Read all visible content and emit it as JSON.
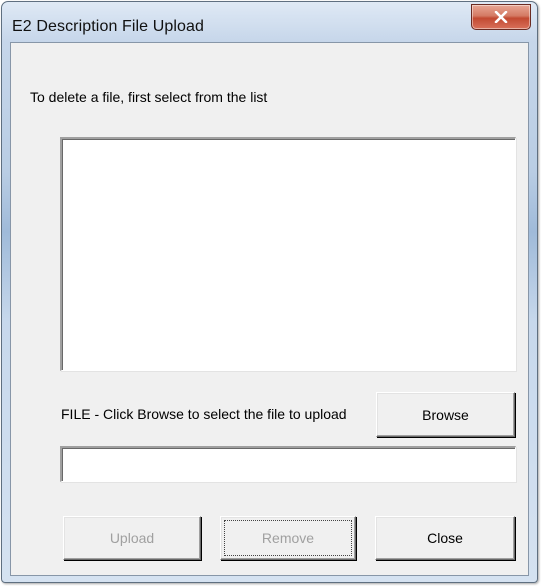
{
  "window": {
    "title": "E2 Description File Upload",
    "close_icon": "close-x-icon"
  },
  "instruction": "To delete a file, first select from the list",
  "file_list": {
    "items": []
  },
  "file_section": {
    "label": "FILE - Click Browse to select the file to upload",
    "browse_label": "Browse",
    "path_value": ""
  },
  "buttons": {
    "upload_label": "Upload",
    "upload_enabled": false,
    "remove_label": "Remove",
    "remove_enabled": false,
    "close_label": "Close"
  },
  "colors": {
    "disabled_text": "#a0a0a0",
    "dialog_face": "#f0f0f0",
    "close_button_red": "#c24a32"
  }
}
